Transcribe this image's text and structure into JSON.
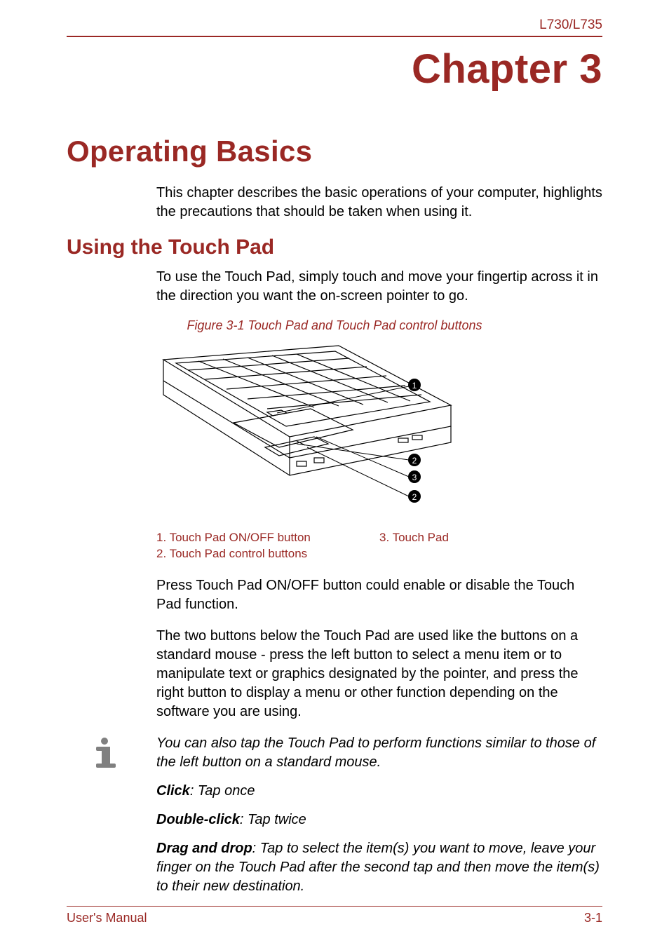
{
  "header": {
    "model": "L730/L735"
  },
  "chapter": {
    "label": "Chapter 3"
  },
  "main_title": "Operating Basics",
  "intro": "This chapter describes the basic operations of your computer, highlights the precautions that should be taken when using it.",
  "section1": {
    "title": "Using the Touch Pad",
    "para1": "To use the Touch Pad, simply touch and move your fingertip across it in the direction you want the on-screen pointer to go."
  },
  "figure": {
    "caption": "Figure 3-1 Touch Pad and Touch Pad control buttons",
    "callouts": {
      "c1": "1",
      "c2": "2",
      "c3": "3",
      "c4": "2"
    },
    "legend": {
      "l1": "1. Touch Pad ON/OFF button",
      "l2": "2. Touch Pad control buttons",
      "l3": "3. Touch Pad"
    }
  },
  "para2": "Press Touch Pad ON/OFF button could enable or disable the Touch Pad function.",
  "para3": "The two buttons below the Touch Pad are used like the buttons on a standard mouse - press the left button to select a menu item or to manipulate text or graphics designated by the pointer, and press the right button to display a menu or other function depending on the software you are using.",
  "info": {
    "p1": "You can also tap the Touch Pad to perform functions similar to those of the left button on a standard mouse.",
    "click_term": "Click",
    "click_text": ": Tap once",
    "dbl_term": "Double-click",
    "dbl_text": ": Tap twice",
    "drag_term": "Drag and drop",
    "drag_text": ": Tap to select the item(s) you want to move, leave your finger on the Touch Pad after the second tap and then move the item(s) to their new destination."
  },
  "footer": {
    "left": "User's Manual",
    "right": "3-1"
  }
}
